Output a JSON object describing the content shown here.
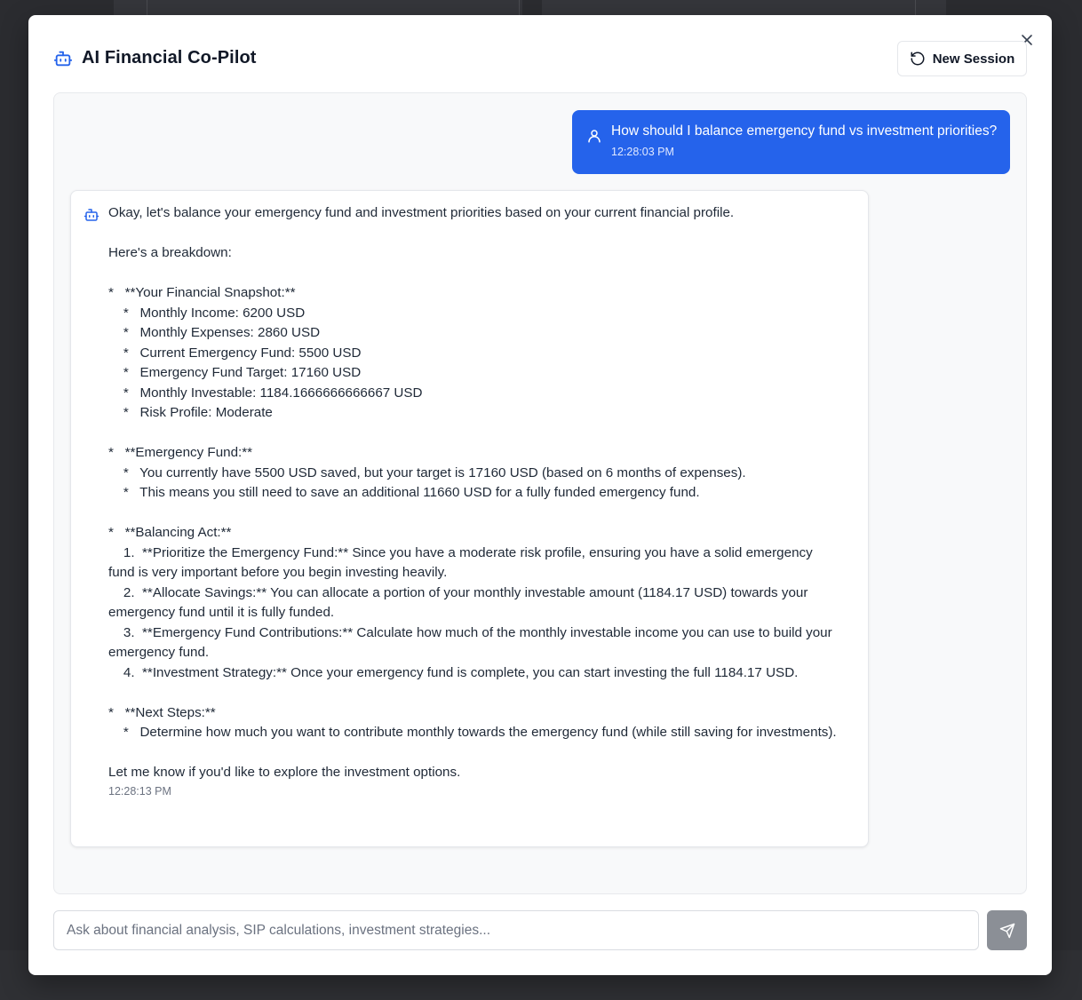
{
  "app": {
    "title": "AI Financial Co-Pilot",
    "new_session_label": "New Session"
  },
  "messages": {
    "user": {
      "text": "How should I balance emergency fund vs investment priorities?",
      "time": "12:28:03 PM"
    },
    "assistant": {
      "text": "Okay, let's balance your emergency fund and investment priorities based on your current financial profile.\n\nHere's a breakdown:\n\n*   **Your Financial Snapshot:**\n    *   Monthly Income: 6200 USD\n    *   Monthly Expenses: 2860 USD\n    *   Current Emergency Fund: 5500 USD\n    *   Emergency Fund Target: 17160 USD\n    *   Monthly Investable: 1184.1666666666667 USD\n    *   Risk Profile: Moderate\n\n*   **Emergency Fund:**\n    *   You currently have 5500 USD saved, but your target is 17160 USD (based on 6 months of expenses).\n    *   This means you still need to save an additional 11660 USD for a fully funded emergency fund.\n\n*   **Balancing Act:**\n    1.  **Prioritize the Emergency Fund:** Since you have a moderate risk profile, ensuring you have a solid emergency fund is very important before you begin investing heavily.\n    2.  **Allocate Savings:** You can allocate a portion of your monthly investable amount (1184.17 USD) towards your emergency fund until it is fully funded.\n    3.  **Emergency Fund Contributions:** Calculate how much of the monthly investable income you can use to build your emergency fund.\n    4.  **Investment Strategy:** Once your emergency fund is complete, you can start investing the full 1184.17 USD.\n\n*   **Next Steps:**\n    *   Determine how much you want to contribute monthly towards the emergency fund (while still saving for investments).\n\nLet me know if you'd like to explore the investment options.",
      "time": "12:28:13 PM"
    }
  },
  "input": {
    "placeholder": "Ask about financial analysis, SIP calculations, investment strategies...",
    "value": ""
  },
  "icons": {
    "header": "bot-icon",
    "new_session": "refresh-icon",
    "close": "close-icon",
    "user": "user-icon",
    "assistant": "bot-icon",
    "send": "send-icon"
  },
  "colors": {
    "accent": "#2563eb",
    "send_disabled": "#8b8f96",
    "backdrop": "#2b2c30"
  }
}
